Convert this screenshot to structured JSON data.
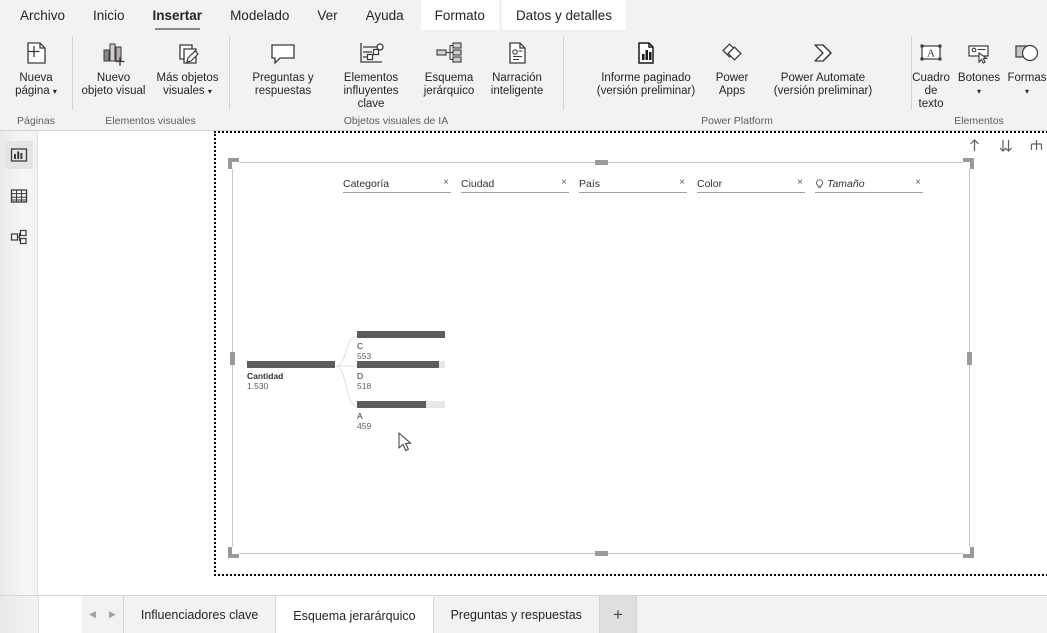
{
  "app": {
    "title": "Power BI Desktop"
  },
  "ribbon_tabs": [
    {
      "label": "Archivo",
      "active": false,
      "contextual": false
    },
    {
      "label": "Inicio",
      "active": false,
      "contextual": false
    },
    {
      "label": "Insertar",
      "active": true,
      "contextual": false
    },
    {
      "label": "Modelado",
      "active": false,
      "contextual": false
    },
    {
      "label": "Ver",
      "active": false,
      "contextual": false
    },
    {
      "label": "Ayuda",
      "active": false,
      "contextual": false
    },
    {
      "label": "Formato",
      "active": false,
      "contextual": true
    },
    {
      "label": "Datos y detalles",
      "active": false,
      "contextual": true
    }
  ],
  "ribbon_groups": [
    {
      "label": "Páginas",
      "items": [
        {
          "label": "Nueva página",
          "icon": "new-page-icon",
          "caret": true
        }
      ]
    },
    {
      "label": "Elementos visuales",
      "items": [
        {
          "label": "Nuevo objeto visual",
          "icon": "new-visual-icon",
          "caret": false
        },
        {
          "label": "Más objetos visuales",
          "icon": "more-visuals-icon",
          "caret": true
        }
      ]
    },
    {
      "label": "Objetos visuales de IA",
      "items": [
        {
          "label": "Preguntas y respuestas",
          "icon": "qna-icon",
          "caret": false
        },
        {
          "label": "Elementos influyentes clave",
          "icon": "key-influencers-icon",
          "caret": false
        },
        {
          "label": "Esquema jerárquico",
          "icon": "decomposition-tree-icon",
          "caret": false
        },
        {
          "label": "Narración inteligente",
          "icon": "smart-narrative-icon",
          "caret": false
        }
      ]
    },
    {
      "label": "Power Platform",
      "items": [
        {
          "label": "Informe paginado (versión preliminar)",
          "icon": "paginated-report-icon",
          "caret": false
        },
        {
          "label": "Power Apps",
          "icon": "power-apps-icon",
          "caret": false
        },
        {
          "label": "Power Automate (versión preliminar)",
          "icon": "power-automate-icon",
          "caret": false
        }
      ]
    },
    {
      "label": "Elementos",
      "items": [
        {
          "label": "Cuadro de texto",
          "icon": "text-box-icon",
          "caret": false
        },
        {
          "label": "Botones",
          "icon": "buttons-icon",
          "caret": true
        },
        {
          "label": "Formas",
          "icon": "shapes-icon",
          "caret": true
        }
      ]
    }
  ],
  "view_switcher": [
    {
      "name": "report-view",
      "icon": "report-chart-icon",
      "active": true
    },
    {
      "name": "data-view",
      "icon": "data-table-icon",
      "active": false
    },
    {
      "name": "model-view",
      "icon": "model-relationship-icon",
      "active": false
    }
  ],
  "visual_toolbar": [
    {
      "name": "level-up-button",
      "icon": "arrow-up-icon"
    },
    {
      "name": "expand-all-button",
      "icon": "double-arrow-down-icon"
    },
    {
      "name": "tree-split-button",
      "icon": "tree-split-icon"
    },
    {
      "name": "filter-button",
      "icon": "filter-funnel-icon"
    },
    {
      "name": "focus-mode-button",
      "icon": "focus-mode-icon"
    },
    {
      "name": "more-options-button",
      "icon": "ellipsis-icon"
    }
  ],
  "decomposition_tree": {
    "fields": [
      {
        "label": "Categoría",
        "italic": false,
        "bulb": false,
        "close": "×"
      },
      {
        "label": "Ciudad",
        "italic": false,
        "bulb": false,
        "close": "×"
      },
      {
        "label": "País",
        "italic": false,
        "bulb": false,
        "close": "×"
      },
      {
        "label": "Color",
        "italic": false,
        "bulb": false,
        "close": "×"
      },
      {
        "label": "Tamaño",
        "italic": true,
        "bulb": true,
        "close": "×"
      }
    ],
    "root": {
      "label": "Cantidad",
      "value": "1.530",
      "fill_pct": 100
    },
    "children": [
      {
        "label": "C",
        "value": "553",
        "fill_pct": 100
      },
      {
        "label": "D",
        "value": "518",
        "fill_pct": 93
      },
      {
        "label": "A",
        "value": "459",
        "fill_pct": 78
      }
    ]
  },
  "page_tabs": {
    "prev_arrow": "◀",
    "next_arrow": "▶",
    "add_label": "+",
    "tabs": [
      {
        "label": "Influenciadores clave",
        "active": false
      },
      {
        "label": "Esquema jerarárquico",
        "active": true
      },
      {
        "label": "Preguntas y respuestas",
        "active": false
      }
    ]
  }
}
